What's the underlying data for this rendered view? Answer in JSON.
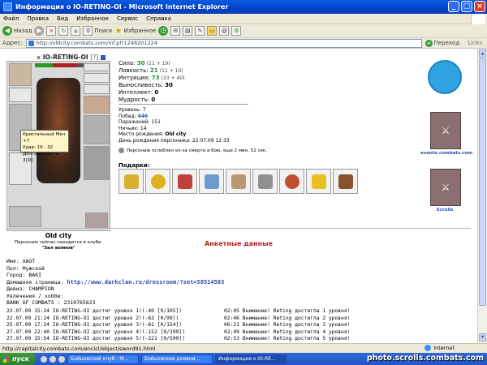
{
  "window": {
    "title": "Информация о IO-RETING-OI - Microsoft Internet Explorer"
  },
  "menu": [
    "Файл",
    "Правка",
    "Вид",
    "Избранное",
    "Сервис",
    "Справка"
  ],
  "toolbar": {
    "back": "Назад",
    "search": "Поиск",
    "favorites": "Избранное"
  },
  "address": {
    "label": "Адрес:",
    "url": "http://oldcity.combats.com/inf.pl?1248201224",
    "go": "Переход",
    "links": "Links"
  },
  "character": {
    "name": "IO-RETING-OI",
    "level_tag": "[?]",
    "stats": [
      {
        "label": "Сила:",
        "value": "30",
        "extra": "(11 + 19)"
      },
      {
        "label": "Ловкость:",
        "value": "21",
        "extra": "(11 + 10)"
      },
      {
        "label": "Интуиция:",
        "value": "73",
        "extra": "(33 + 40)"
      },
      {
        "label": "Выносливость:",
        "value": "30",
        "extra": ""
      },
      {
        "label": "Интеллект:",
        "value": "0",
        "extra": ""
      },
      {
        "label": "Мудрость:",
        "value": "0",
        "extra": ""
      }
    ],
    "info": [
      {
        "label": "Уровень:",
        "value": "7"
      },
      {
        "label": "Побед:",
        "value": "446"
      },
      {
        "label": "Поражений:",
        "value": "151"
      },
      {
        "label": "Ничьих:",
        "value": "14"
      },
      {
        "label": "Место рождения:",
        "value": "Old city"
      },
      {
        "label": "День рождения персонажа:",
        "value": "22.07.09 12:33"
      }
    ],
    "weak": "Персонаж ослаблен из-за смерти в бою, еще 2 мин. 52 сек.",
    "gifts_label": "Подарки:",
    "tooltip": [
      "Кристальный Меч +7",
      "Удар: 19 - 32",
      "Долговечность: 3|30"
    ],
    "city": "Old city",
    "location_note": [
      "Персонаж сейчас находится в клубе.",
      "\"Зал воинов\""
    ]
  },
  "right": {
    "events": "events.combats.com",
    "scrolls": "Scrolls"
  },
  "anketa": {
    "title": "Анкетные данные",
    "lines": [
      "Имя: ХАОТ",
      "Пол: Мужской",
      "Город: BAKI"
    ],
    "homepage_label": "Домашняя страница:",
    "homepage_url": "http://www.darkclan.ru/dressroom/?set=58514503",
    "rest": [
      "Девиз: CHAMPION",
      "Увлечения / хобби:",
      "BANK OF COMBATS : 2310765623"
    ]
  },
  "log": [
    {
      "l": "22.07.09 15:24 IO-RETING-OI достиг уровня 1!(-40 [9/105])",
      "r": "02:05 Внимание! Reting достигла 1 уровня!"
    },
    {
      "l": "22.07.09 21:24 IO-RETING-OI достиг уровня 2!(-63 [0/99])",
      "r": "02:46 Внимание! Reting достигла 2 уровня!"
    },
    {
      "l": "25.07.09 17:24 IO-RETING-OI достиг уровня 3!(-81 [0/154])",
      "r": "06:21 Внимание! Reting достигла 3 уровня!"
    },
    {
      "l": "27.07.09 22:40 IO-RETING-OI достиг уровня 4!(-152 [0/399])",
      "r": "02:49 Внимание! Reting достигла 4 уровня!"
    },
    {
      "l": "27.07.09 15:54 IO-RETING-OI достиг уровня 5!(-221 [0/599])",
      "r": "02:53 Внимание! Reting достигла 5 уровня!"
    }
  ],
  "status": {
    "url": "http://capitalcity.combats.com/encicl/object/sword91.html",
    "zone": "Internet"
  },
  "taskbar": {
    "start": "пуск",
    "tasks": [
      "Бойцовский клуб - M...",
      "Бойцовские дневни...",
      "Информация о IO-RE..."
    ]
  },
  "watermark": "photo.scrolls.combats.com"
}
